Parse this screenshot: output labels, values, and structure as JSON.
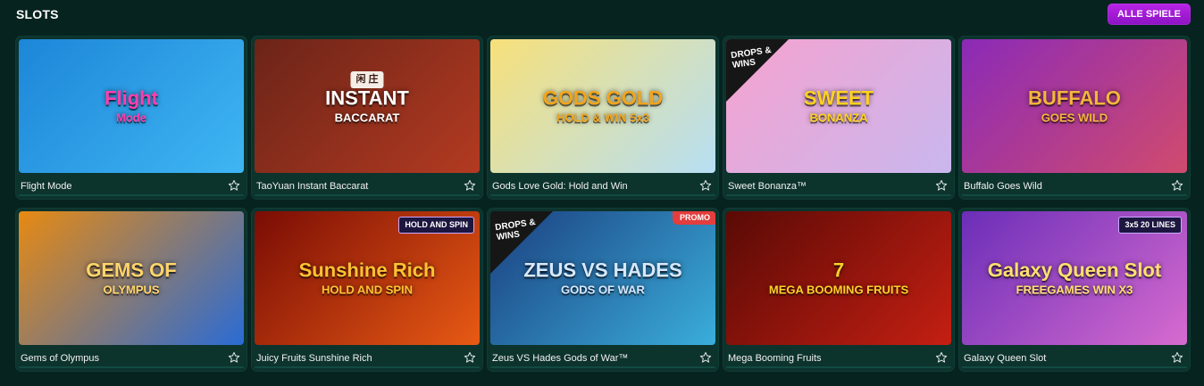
{
  "header": {
    "title": "SLOTS",
    "all_button": "ALLE SPIELE"
  },
  "games": [
    {
      "name": "Flight Mode",
      "art_text": "Flight",
      "art_sub": "Mode",
      "colors": [
        "#1d86d8",
        "#3fb6f3"
      ],
      "art_color": "#ff3fb0"
    },
    {
      "name": "TaoYuan Instant Baccarat",
      "art_text": "INSTANT",
      "art_sub": "BACCARAT",
      "colors": [
        "#6b2418",
        "#b33a21"
      ],
      "art_color": "#ffffff",
      "art_icon": "闲 庄"
    },
    {
      "name": "Gods Love Gold: Hold and Win",
      "art_text": "GODS GOLD",
      "art_sub": "HOLD & WIN  5x3",
      "colors": [
        "#f7e07a",
        "#b6dff4"
      ],
      "art_color": "#f2a41a"
    },
    {
      "name": "Sweet Bonanza™",
      "art_text": "SWEET",
      "art_sub": "BONANZA",
      "colors": [
        "#f6a2cf",
        "#c9b7ee"
      ],
      "art_color": "#ffd21e",
      "drops": "DROPS & WINS"
    },
    {
      "name": "Buffalo Goes Wild",
      "art_text": "BUFFALO",
      "art_sub": "GOES WILD",
      "colors": [
        "#8b2ab7",
        "#d04b6e"
      ],
      "art_color": "#f4b53c"
    },
    {
      "name": "Gems of Olympus",
      "art_text": "GEMS OF",
      "art_sub": "OLYMPUS",
      "colors": [
        "#e78a12",
        "#2a6bd5"
      ],
      "art_color": "#ffd56b"
    },
    {
      "name": "Juicy Fruits Sunshine Rich",
      "art_text": "Sunshine Rich",
      "art_sub": "HOLD AND SPIN",
      "colors": [
        "#7a0c05",
        "#e85a14"
      ],
      "art_color": "#ffc233",
      "badge": "HOLD AND SPIN"
    },
    {
      "name": "Zeus VS Hades Gods of War™",
      "art_text": "ZEUS VS HADES",
      "art_sub": "GODS OF WAR",
      "colors": [
        "#1b3f7f",
        "#3aaedb"
      ],
      "art_color": "#d6e9ff",
      "drops": "DROPS & WINS",
      "promo": "PROMO"
    },
    {
      "name": "Mega Booming Fruits",
      "art_text": "7",
      "art_sub": "MEGA BOOMING FRUITS",
      "colors": [
        "#5a0a06",
        "#c41f12"
      ],
      "art_color": "#ffd02a"
    },
    {
      "name": "Galaxy Queen Slot",
      "art_text": "Galaxy Queen Slot",
      "art_sub": "FREEGAMES WIN X3",
      "colors": [
        "#6b2eb8",
        "#d66bcf"
      ],
      "art_color": "#ffe070",
      "badge": "3x5  20 LINES"
    }
  ]
}
